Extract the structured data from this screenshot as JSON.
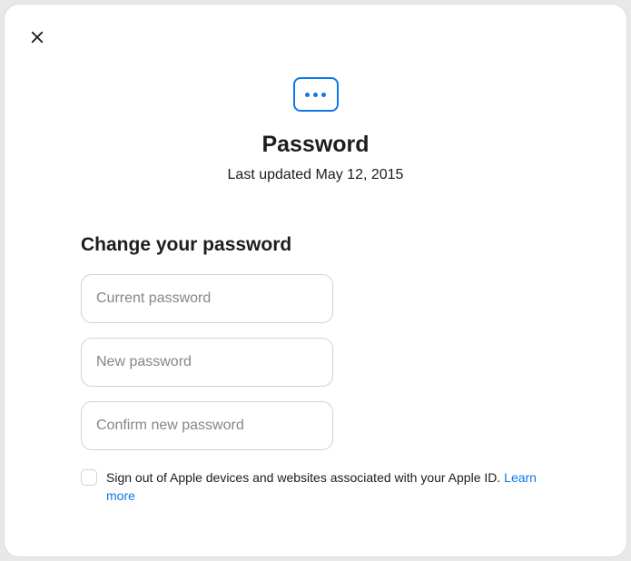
{
  "header": {
    "title": "Password",
    "subtitle": "Last updated May 12, 2015"
  },
  "form": {
    "heading": "Change your password",
    "current_placeholder": "Current password",
    "new_placeholder": "New password",
    "confirm_placeholder": "Confirm new password"
  },
  "signout": {
    "label": "Sign out of Apple devices and websites associated with your Apple ID. ",
    "link": "Learn more"
  },
  "icons": {
    "close": "close-icon",
    "password": "password-dots-icon"
  }
}
